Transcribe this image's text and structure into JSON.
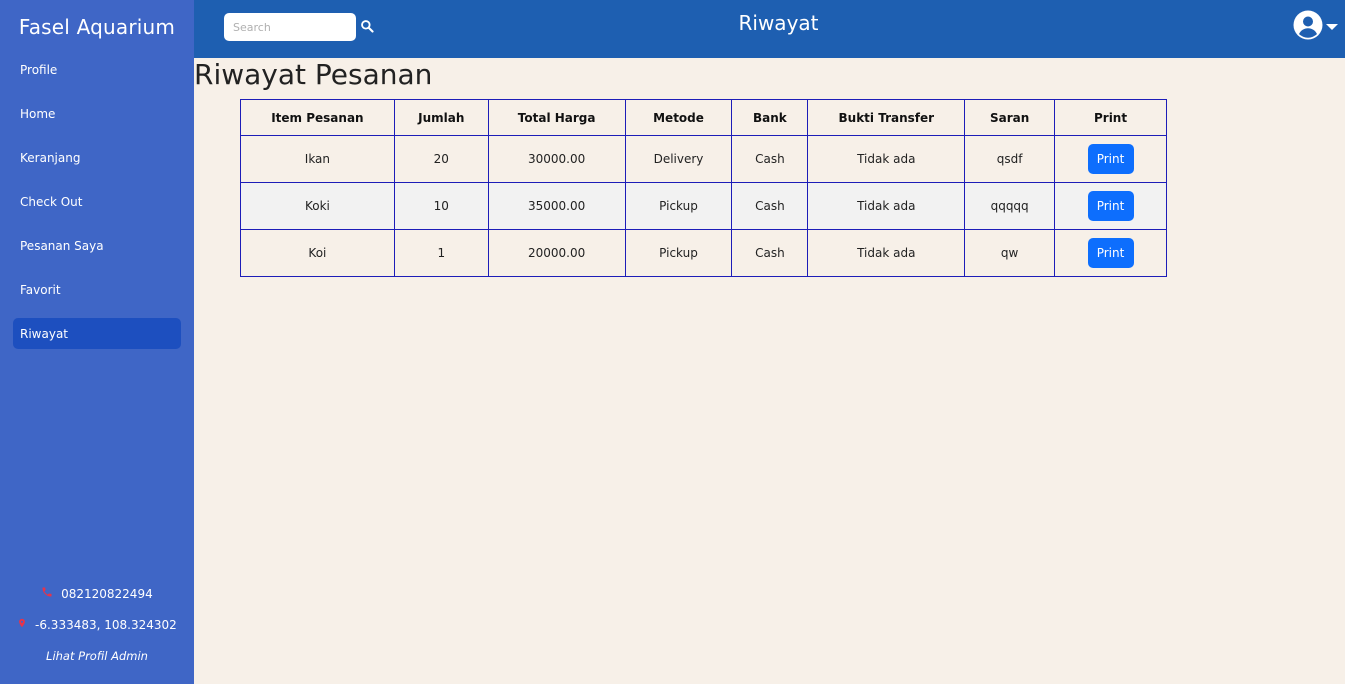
{
  "app": {
    "brand": "Fasel Aquarium"
  },
  "sidebar": {
    "items": [
      {
        "label": "Profile"
      },
      {
        "label": "Home"
      },
      {
        "label": "Keranjang"
      },
      {
        "label": "Check Out"
      },
      {
        "label": "Pesanan Saya"
      },
      {
        "label": "Favorit"
      },
      {
        "label": "Riwayat",
        "active": true
      }
    ],
    "footer": {
      "phone": "082120822494",
      "phone_icon": "phone-icon",
      "coordinates": "-6.333483, 108.324302",
      "coordinates_icon": "map-pin-icon",
      "admin_link": "Lihat Profil Admin"
    }
  },
  "topbar": {
    "search_placeholder": "Search",
    "search_icon": "search-icon",
    "title": "Riwayat",
    "user_icon": "user-circle-icon"
  },
  "main": {
    "title": "Riwayat Pesanan",
    "table": {
      "headers": [
        "Item Pesanan",
        "Jumlah",
        "Total Harga",
        "Metode",
        "Bank",
        "Bukti Transfer",
        "Saran",
        "Print"
      ],
      "rows": [
        {
          "item": "Ikan",
          "jumlah": "20",
          "total": "30000.00",
          "metode": "Delivery",
          "bank": "Cash",
          "bukti": "Tidak ada",
          "saran": "qsdf",
          "print": "Print"
        },
        {
          "item": "Koki",
          "jumlah": "10",
          "total": "35000.00",
          "metode": "Pickup",
          "bank": "Cash",
          "bukti": "Tidak ada",
          "saran": "qqqqq",
          "print": "Print"
        },
        {
          "item": "Koi",
          "jumlah": "1",
          "total": "20000.00",
          "metode": "Pickup",
          "bank": "Cash",
          "bukti": "Tidak ada",
          "saran": "qw",
          "print": "Print"
        }
      ]
    }
  },
  "colors": {
    "sidebar_bg": "#3f66c6",
    "sidebar_active": "#1d4fbf",
    "topbar_bg": "#1e5fb1",
    "page_bg": "#f7f0e8",
    "table_border": "#1d1db8",
    "button_primary": "#0d6efd"
  }
}
